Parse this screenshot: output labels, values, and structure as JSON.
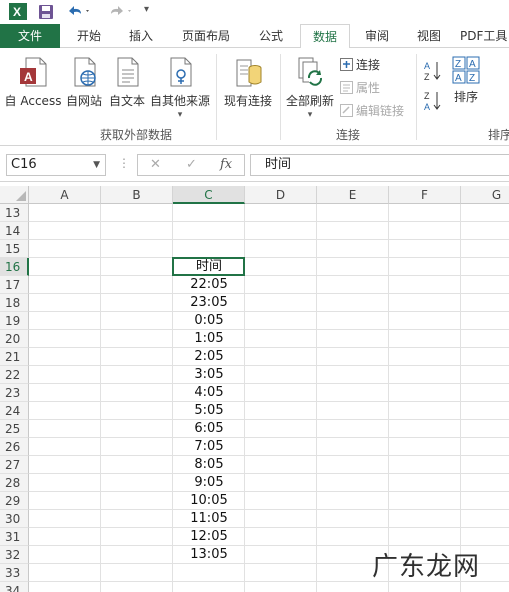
{
  "quick_access": {
    "icons": [
      "excel-logo-icon",
      "save-icon",
      "undo-icon",
      "redo-icon",
      "customize-icon"
    ]
  },
  "tabs": [
    {
      "label": "文件"
    },
    {
      "label": "开始"
    },
    {
      "label": "插入"
    },
    {
      "label": "页面布局"
    },
    {
      "label": "公式"
    },
    {
      "label": "数据"
    },
    {
      "label": "审阅"
    },
    {
      "label": "视图"
    },
    {
      "label": "PDF工具"
    }
  ],
  "ribbon": {
    "get_external": {
      "buttons": [
        {
          "label": "自 Access"
        },
        {
          "label": "自网站"
        },
        {
          "label": "自文本"
        },
        {
          "label": "自其他来源"
        }
      ],
      "group_label": "获取外部数据"
    },
    "existing_conn": {
      "label": "现有连接"
    },
    "connections": {
      "refresh_all": "全部刷新",
      "connections": "连接",
      "properties": "属性",
      "edit_links": "编辑链接",
      "group_label": "连接"
    },
    "sort": {
      "sort_label": "排序",
      "group_label": "排序"
    }
  },
  "formula_bar": {
    "name_box": "C16",
    "fx": "fx",
    "value": "时间"
  },
  "sheet": {
    "columns": [
      "A",
      "B",
      "C",
      "D",
      "E",
      "F",
      "G"
    ],
    "rows": [
      "13",
      "14",
      "15",
      "16",
      "17",
      "18",
      "19",
      "20",
      "21",
      "22",
      "23",
      "24",
      "25",
      "26",
      "27",
      "28",
      "29",
      "30",
      "31",
      "32",
      "33",
      "34"
    ],
    "column_c": {
      "16": "时间",
      "17": "22:05",
      "18": "23:05",
      "19": "0:05",
      "20": "1:05",
      "21": "2:05",
      "22": "3:05",
      "23": "4:05",
      "24": "5:05",
      "25": "6:05",
      "26": "7:05",
      "27": "8:05",
      "28": "9:05",
      "29": "10:05",
      "30": "11:05",
      "31": "12:05",
      "32": "13:05"
    },
    "selected_cell": "C16"
  },
  "watermark": "广东龙网",
  "colors": {
    "accent": "#217346",
    "access_red": "#a4373a",
    "icon_blue": "#2b6cb0"
  }
}
